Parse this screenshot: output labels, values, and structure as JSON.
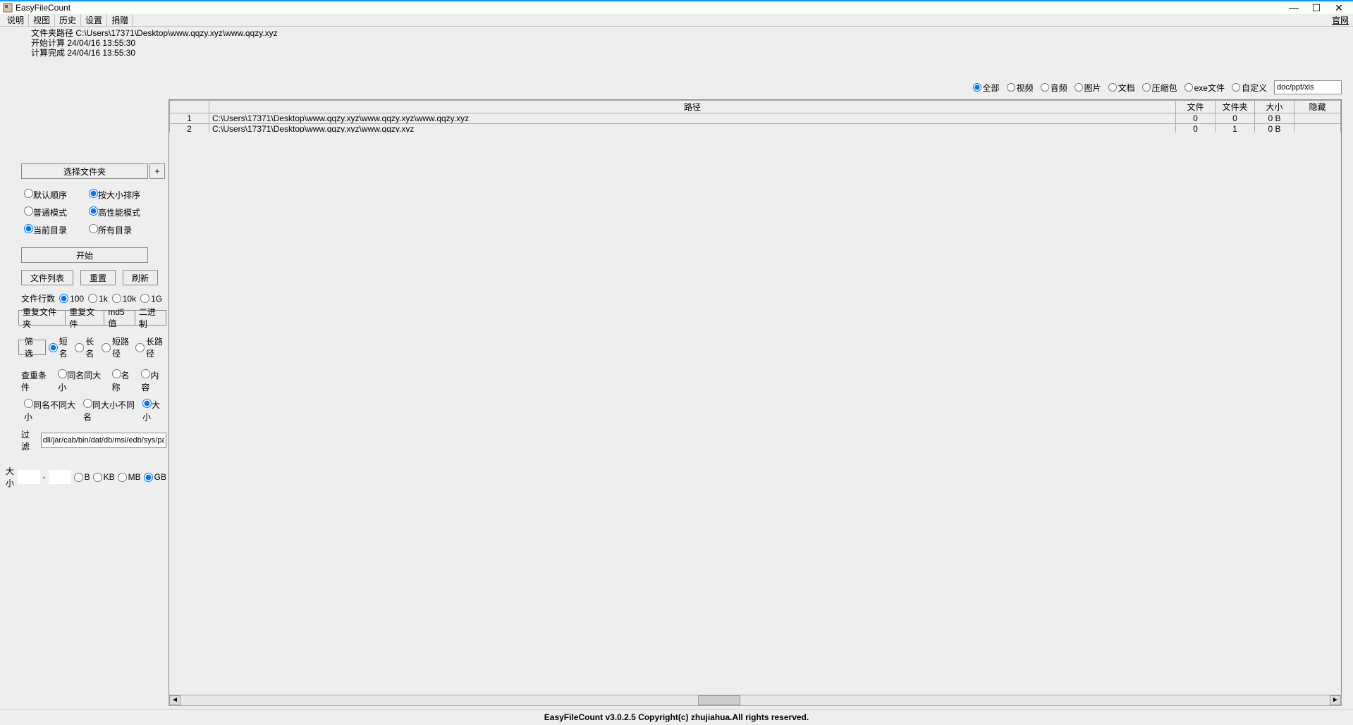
{
  "window": {
    "title": "EasyFileCount",
    "min": "—",
    "max": "☐",
    "close": "✕"
  },
  "menu": {
    "items": [
      "说明",
      "视图",
      "历史",
      "设置",
      "捐赠"
    ],
    "official": "官网"
  },
  "status": {
    "line1": "文件夹路径 C:\\Users\\17371\\Desktop\\www.qqzy.xyz\\www.qqzy.xyz",
    "line2": "开始计算 24/04/16 13:55:30",
    "line3": "计算完成 24/04/16 13:55:30"
  },
  "typeFilter": {
    "all": "全部",
    "video": "视频",
    "audio": "音频",
    "image": "图片",
    "doc": "文档",
    "archive": "压缩包",
    "exe": "exe文件",
    "custom": "自定义",
    "customValue": "doc/ppt/xls"
  },
  "table": {
    "headers": {
      "path": "路径",
      "file": "文件",
      "folder": "文件夹",
      "size": "大小",
      "hidden": "隐藏"
    },
    "rows": [
      {
        "idx": "1",
        "path": "C:\\Users\\17371\\Desktop\\www.qqzy.xyz\\www.qqzy.xyz\\www.qqzy.xyz",
        "file": "0",
        "folder": "0",
        "size": "0 B",
        "hidden": ""
      },
      {
        "idx": "2",
        "path": "C:\\Users\\17371\\Desktop\\www.qqzy.xyz\\www.qqzy.xyz",
        "file": "0",
        "folder": "1",
        "size": "0 B",
        "hidden": ""
      }
    ]
  },
  "sidebar": {
    "selectFolder": "选择文件夹",
    "plus": "+",
    "order": {
      "default": "默认顺序",
      "bySize": "按大小排序"
    },
    "mode": {
      "normal": "普通模式",
      "perf": "高性能模式"
    },
    "dir": {
      "current": "当前目录",
      "all": "所有目录"
    },
    "start": "开始",
    "buttons": {
      "fileList": "文件列表",
      "reset": "重置",
      "refresh": "刷新"
    },
    "rowsLabel": "文件行数",
    "rows": {
      "r100": "100",
      "r1k": "1k",
      "r10k": "10k",
      "r1g": "1G"
    },
    "dup": {
      "folder": "重复文件夹",
      "file": "重复文件",
      "md5": "md5值",
      "bin": "二进制"
    },
    "filterBtn": "筛选",
    "nameLen": {
      "short": "短名",
      "long": "长名",
      "shortPath": "短路径",
      "longPath": "长路径"
    },
    "condLabel": "查重条件",
    "cond": {
      "nameSize": "同名同大小",
      "name": "名称",
      "content": "内容",
      "nameDiffSize": "同名不同大小",
      "sizeDiffName": "同大小不同名",
      "size": "大小"
    },
    "guolvLabel": "过滤",
    "guolvValue": "dll/jar/cab/bin/dat/db/msi/edb/sys/pak/jsa",
    "sizeLabel": "大小",
    "sizeDash": "-",
    "unit": {
      "b": "B",
      "kb": "KB",
      "mb": "MB",
      "gb": "GB"
    }
  },
  "footer": "EasyFileCount v3.0.2.5 Copyright(c) zhujiahua.All rights reserved.",
  "scroll": {
    "left": "◄",
    "right": "►"
  }
}
